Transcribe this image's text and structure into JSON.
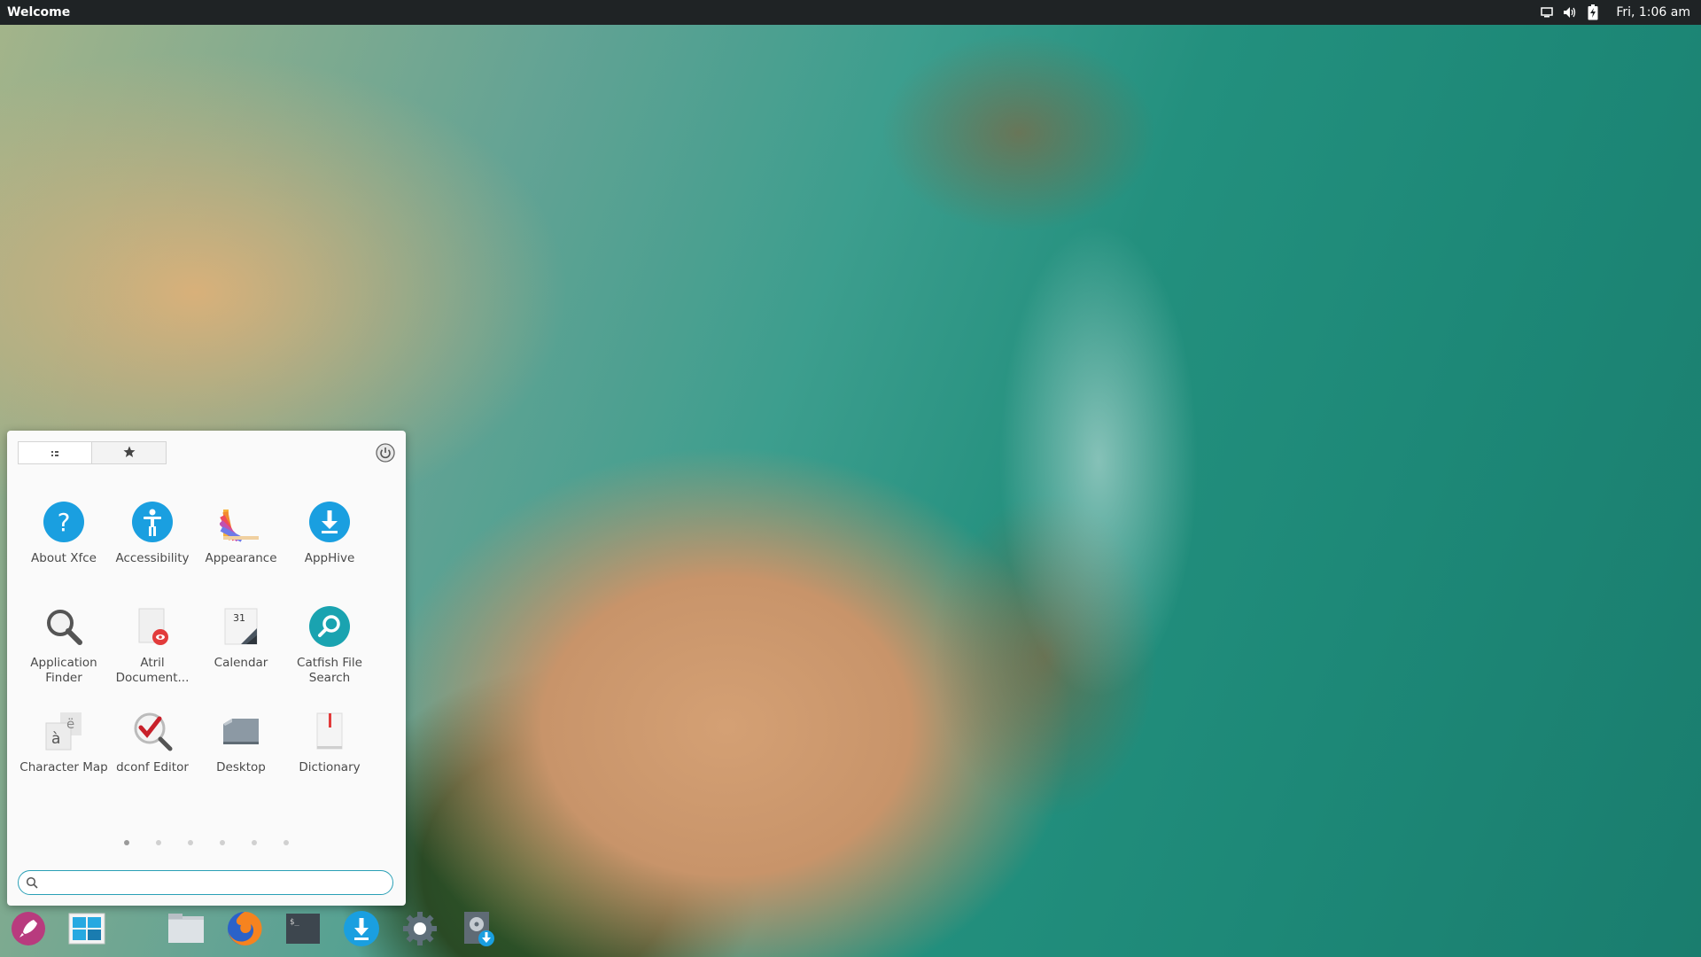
{
  "topbar": {
    "title": "Welcome",
    "clock": "Fri,  1:06 am",
    "tray": [
      "display-icon",
      "volume-icon",
      "battery-icon"
    ]
  },
  "menu": {
    "tabs": [
      {
        "name": "all-apps-tab-icon",
        "glyph": "⠿"
      },
      {
        "name": "favorites-tab-icon",
        "glyph": "★"
      }
    ],
    "apps": [
      {
        "label": "About Xfce",
        "icon": "help-icon"
      },
      {
        "label": "Accessibility",
        "icon": "accessibility-icon"
      },
      {
        "label": "Appearance",
        "icon": "appearance-icon"
      },
      {
        "label": "AppHive",
        "icon": "download-icon"
      },
      {
        "label": "Application Finder",
        "icon": "magnifier-icon"
      },
      {
        "label": "Atril Document...",
        "icon": "document-viewer-icon"
      },
      {
        "label": "Calendar",
        "icon": "calendar-icon"
      },
      {
        "label": "Catfish File Search",
        "icon": "catfish-search-icon"
      },
      {
        "label": "Character Map",
        "icon": "character-map-icon"
      },
      {
        "label": "dconf Editor",
        "icon": "dconf-editor-icon"
      },
      {
        "label": "Desktop",
        "icon": "desktop-icon"
      },
      {
        "label": "Dictionary",
        "icon": "dictionary-icon"
      }
    ],
    "calendar_day": "31",
    "charmap_glyphs": [
      "à",
      "ë"
    ],
    "pages": 6,
    "active_page": 1,
    "search": {
      "value": "",
      "placeholder": ""
    }
  },
  "dock": {
    "items": [
      "rocket-launcher-icon",
      "workspace-icon",
      "files-icon",
      "firefox-icon",
      "terminal-icon",
      "apphive-download-icon",
      "settings-gear-icon",
      "disk-installer-icon"
    ]
  },
  "colors": {
    "topbar_bg": "#1f2325",
    "accent_blue": "#1a9fe0",
    "accent_teal": "#1aa3b0",
    "search_border": "#2aa0b6"
  }
}
